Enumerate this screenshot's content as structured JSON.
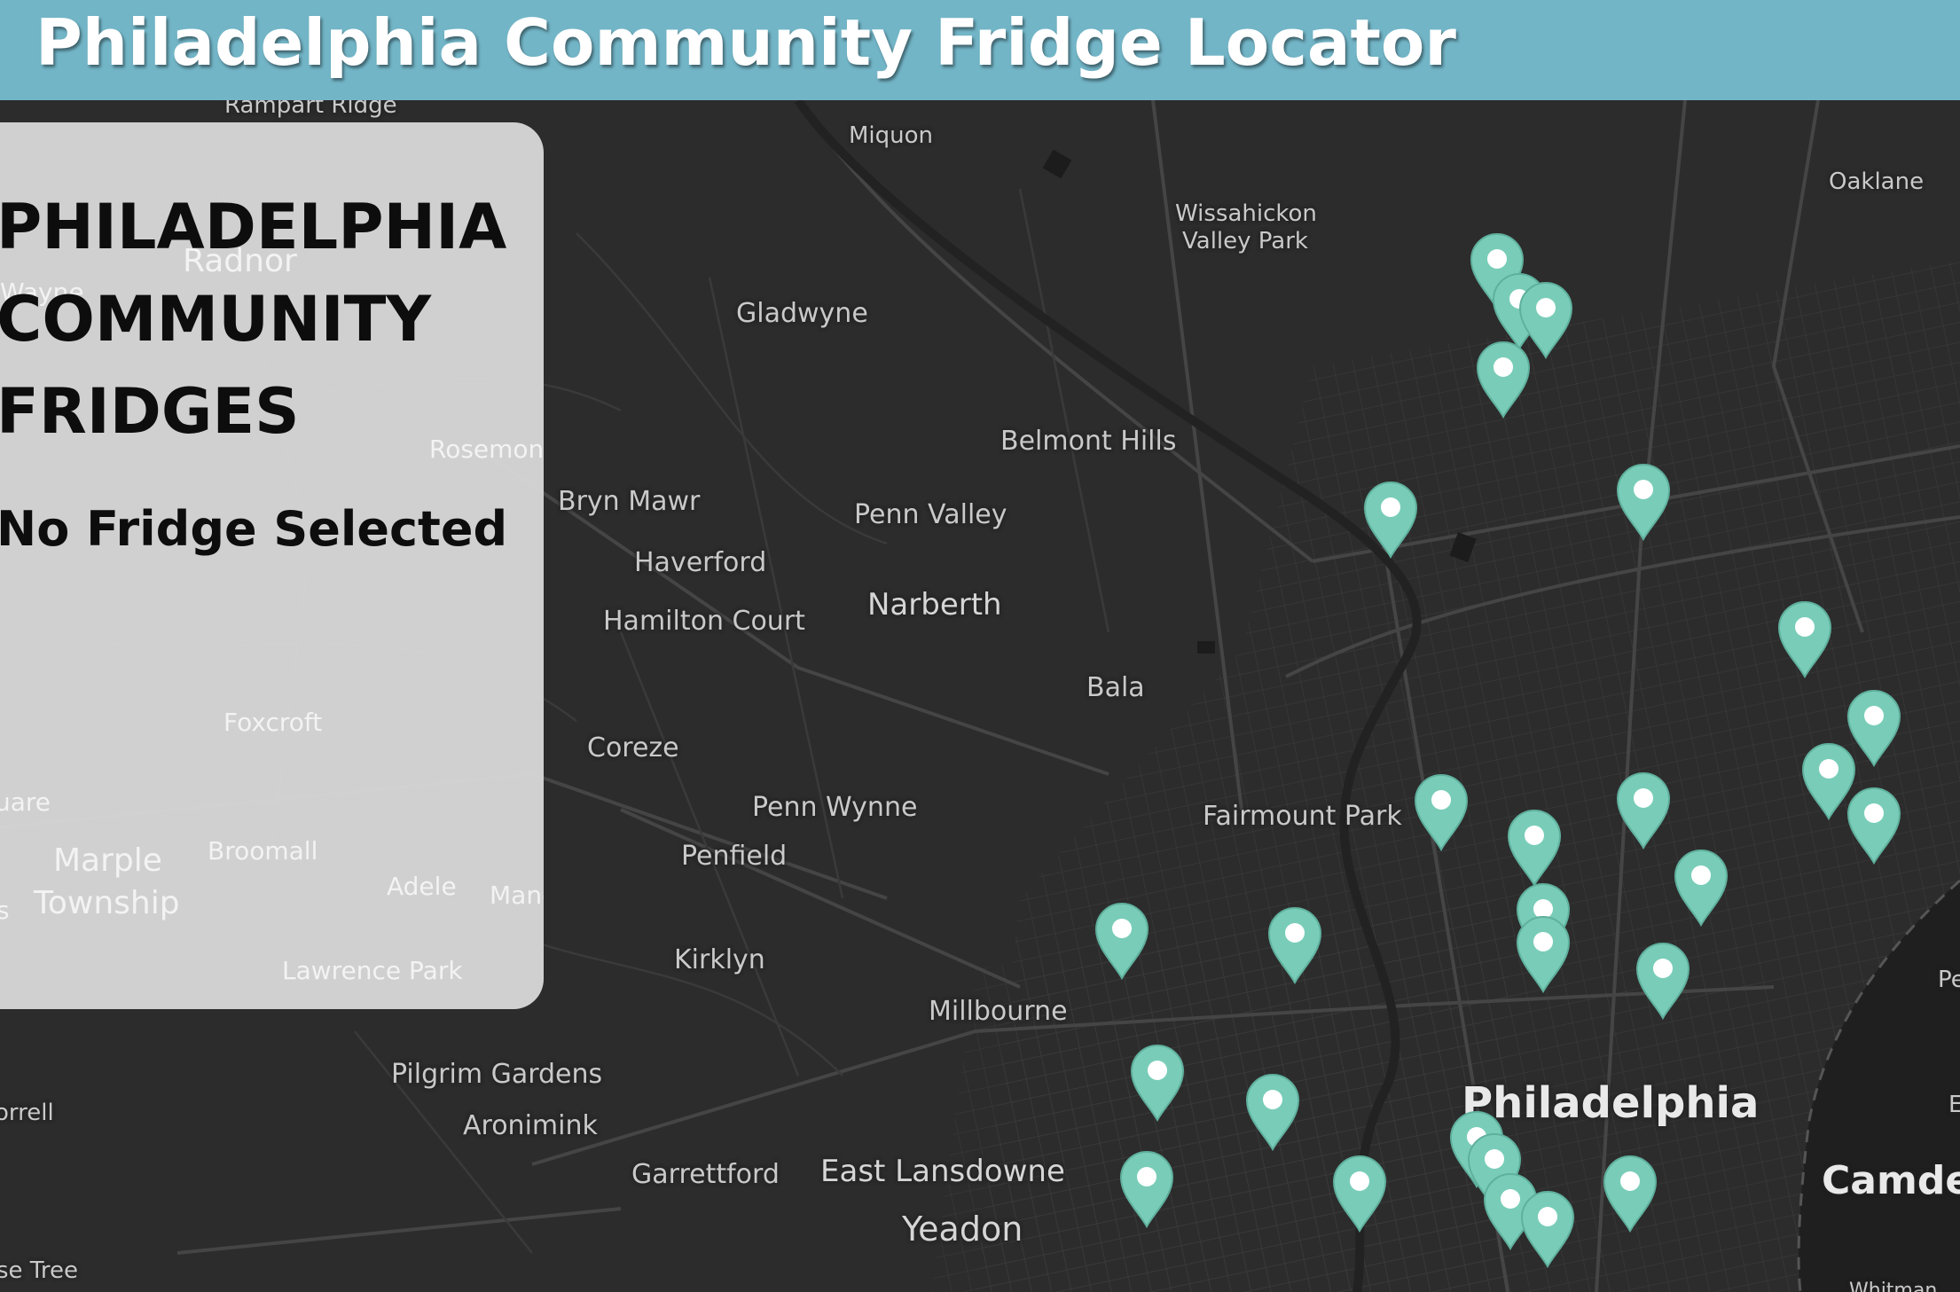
{
  "header": {
    "title": "Philadelphia Community Fridge Locator"
  },
  "panel": {
    "title": "PHILADELPHIA COMMUNITY FRIDGES",
    "status": "No Fridge Selected"
  },
  "map": {
    "places": {
      "rampart_ridge": "Rampart Ridge",
      "miquon": "Miquon",
      "oaklane": "Oaklane",
      "wissahickon": "Wissahickon",
      "valley_park": "Valley Park",
      "wayne": "Wayne",
      "radnor": "Radnor",
      "gladwyne": "Gladwyne",
      "rosemont": "Rosemont",
      "belmont_hills": "Belmont Hills",
      "bryn_mawr": "Bryn Mawr",
      "penn_valley": "Penn Valley",
      "haverford": "Haverford",
      "narberth": "Narberth",
      "hamilton_court": "Hamilton Court",
      "bala": "Bala",
      "foxcroft": "Foxcroft",
      "coreze": "Coreze",
      "uare": "uare",
      "penn_wynne": "Penn Wynne",
      "fairmount_park": "Fairmount Park",
      "marple": "Marple",
      "township": "Township",
      "broomall": "Broomall",
      "penfield": "Penfield",
      "adele": "Adele",
      "manoa": "Manoa",
      "s": "s",
      "kirklyn": "Kirklyn",
      "lawrence_park": "Lawrence Park",
      "millbourne": "Millbourne",
      "pilgrim_gardens": "Pilgrim Gardens",
      "orrell": "orrell",
      "aronimink": "Aronimink",
      "philadelphia": "Philadelphia",
      "garrettford": "Garrettford",
      "east_lansdowne": "East Lansdowne",
      "camden": "Camden",
      "yeadon": "Yeadon",
      "se_tree": "se Tree",
      "pe": "Pe",
      "e": "E",
      "whitman": "Whitman"
    },
    "pin_color": "#79cdb8",
    "background_color": "#2c2c2c"
  },
  "colors": {
    "header": "#72b5c7",
    "panel": "#d6d6d6",
    "title_text": "#ffffff"
  }
}
